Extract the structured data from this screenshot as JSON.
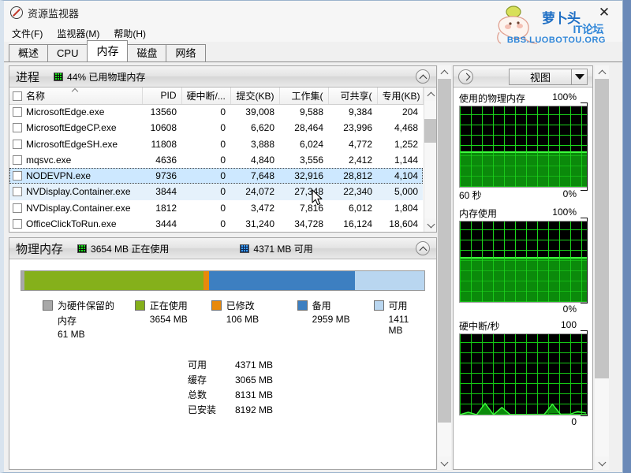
{
  "window": {
    "title": "资源监视器",
    "app_icon": "prohibited-circle-icon",
    "close_label": "✕"
  },
  "watermark": {
    "line1": "萝卜头",
    "line2": "IT论坛",
    "line3": "BBS.LUOBOTOU.ORG"
  },
  "menu": {
    "items": [
      {
        "label": "文件(F)"
      },
      {
        "label": "监视器(M)"
      },
      {
        "label": "帮助(H)"
      }
    ]
  },
  "tabs": {
    "active": "内存",
    "items": [
      {
        "label": "概述"
      },
      {
        "label": "CPU"
      },
      {
        "label": "内存"
      },
      {
        "label": "磁盘"
      },
      {
        "label": "网络"
      }
    ]
  },
  "processes_panel": {
    "title": "进程",
    "status": "44% 已用物理内存",
    "status_swatch": "green-graph-swatch",
    "collapse_icon": "chevron-up-icon",
    "columns": [
      {
        "label": "名称",
        "align": "left"
      },
      {
        "label": "PID",
        "align": "right"
      },
      {
        "label": "硬中断/...",
        "align": "right"
      },
      {
        "label": "提交(KB)",
        "align": "right"
      },
      {
        "label": "工作集(",
        "align": "right"
      },
      {
        "label": "可共享(",
        "align": "right"
      },
      {
        "label": "专用(KB)",
        "align": "right"
      }
    ],
    "rows": [
      {
        "name": "MicrosoftEdge.exe",
        "pid": "13560",
        "hard_faults": "0",
        "commit": "39,008",
        "working_set": "9,588",
        "shareable": "9,384",
        "private": "204",
        "state": "normal"
      },
      {
        "name": "MicrosoftEdgeCP.exe",
        "pid": "10608",
        "hard_faults": "0",
        "commit": "6,620",
        "working_set": "28,464",
        "shareable": "23,996",
        "private": "4,468",
        "state": "normal"
      },
      {
        "name": "MicrosoftEdgeSH.exe",
        "pid": "11808",
        "hard_faults": "0",
        "commit": "3,888",
        "working_set": "6,024",
        "shareable": "4,772",
        "private": "1,252",
        "state": "normal"
      },
      {
        "name": "mqsvc.exe",
        "pid": "4636",
        "hard_faults": "0",
        "commit": "4,840",
        "working_set": "3,556",
        "shareable": "2,412",
        "private": "1,144",
        "state": "normal"
      },
      {
        "name": "NODEVPN.exe",
        "pid": "9736",
        "hard_faults": "0",
        "commit": "7,648",
        "working_set": "32,916",
        "shareable": "28,812",
        "private": "4,104",
        "state": "selected"
      },
      {
        "name": "NVDisplay.Container.exe",
        "pid": "3844",
        "hard_faults": "0",
        "commit": "24,072",
        "working_set": "27,348",
        "shareable": "22,340",
        "private": "5,000",
        "state": "hover"
      },
      {
        "name": "NVDisplay.Container.exe",
        "pid": "1812",
        "hard_faults": "0",
        "commit": "3,472",
        "working_set": "7,816",
        "shareable": "6,012",
        "private": "1,804",
        "state": "normal"
      },
      {
        "name": "OfficeClickToRun.exe",
        "pid": "3444",
        "hard_faults": "0",
        "commit": "31,240",
        "working_set": "34,728",
        "shareable": "16,124",
        "private": "18,604",
        "state": "normal"
      }
    ]
  },
  "memory_panel": {
    "title": "物理内存",
    "stat_in_use": "3654 MB 正在使用",
    "stat_available": "4371 MB 可用",
    "collapse_icon": "chevron-up-icon",
    "bar_segments": [
      {
        "key": "hardware_reserved",
        "label": "为硬件保留的",
        "label2": "内存",
        "value": "61 MB",
        "color": "#a8a8a8",
        "pct": 0.75
      },
      {
        "key": "in_use",
        "label": "正在使用",
        "label2": "",
        "value": "3654 MB",
        "color": "#85b01b",
        "pct": 44.5
      },
      {
        "key": "modified",
        "label": "已修改",
        "label2": "",
        "value": "106 MB",
        "color": "#e8890c",
        "pct": 1.3
      },
      {
        "key": "standby",
        "label": "备用",
        "label2": "",
        "value": "2959 MB",
        "color": "#3d7fc1",
        "pct": 36.2
      },
      {
        "key": "free",
        "label": "可用",
        "label2": "",
        "value": "1411 MB",
        "color": "#b9d6f0",
        "pct": 17.25
      }
    ],
    "stats": [
      {
        "key": "可用",
        "value": "4371 MB"
      },
      {
        "key": "缓存",
        "value": "3065 MB"
      },
      {
        "key": "总数",
        "value": "8131 MB"
      },
      {
        "key": "已安装",
        "value": "8192 MB"
      }
    ]
  },
  "graph_panel": {
    "expand_icon": "chevron-right-icon",
    "view_label": "视图",
    "view_arrow_icon": "chevron-down-icon",
    "graphs": [
      {
        "title": "使用的物理内存",
        "max": "100%",
        "min": "0%",
        "footer_left": "60 秒",
        "fill_pct": 44,
        "kind": "area"
      },
      {
        "title": "内存使用",
        "max": "100%",
        "min": "0%",
        "footer_left": "",
        "fill_pct": 56,
        "kind": "area"
      },
      {
        "title": "硬中断/秒",
        "max": "100",
        "min": "0",
        "footer_left": "",
        "fill_pct": 0,
        "kind": "spikes"
      }
    ]
  },
  "chart_data": [
    {
      "type": "area",
      "title": "使用的物理内存",
      "ylabel": "",
      "xlabel": "60 秒",
      "ylim": [
        0,
        100
      ],
      "yticks": [
        "0%",
        "100%"
      ],
      "x": [
        0,
        10,
        20,
        30,
        40,
        50,
        60
      ],
      "values": [
        44,
        44,
        44,
        44,
        44,
        44,
        44
      ],
      "grid": true,
      "legend": "none"
    },
    {
      "type": "area",
      "title": "内存使用",
      "ylabel": "",
      "xlabel": "",
      "ylim": [
        0,
        100
      ],
      "yticks": [
        "0%",
        "100%"
      ],
      "x": [
        0,
        10,
        20,
        30,
        40,
        50,
        60
      ],
      "values": [
        56,
        56,
        56,
        56,
        56,
        56,
        56
      ],
      "grid": true,
      "legend": "none"
    },
    {
      "type": "line",
      "title": "硬中断/秒",
      "ylabel": "",
      "xlabel": "",
      "ylim": [
        0,
        100
      ],
      "yticks": [
        "0",
        "100"
      ],
      "x": [
        0,
        4,
        8,
        12,
        16,
        20,
        24,
        28,
        32,
        36,
        40,
        44,
        48,
        52,
        56,
        60
      ],
      "values": [
        0,
        3,
        0,
        14,
        0,
        9,
        0,
        0,
        0,
        0,
        0,
        13,
        0,
        0,
        4,
        2
      ],
      "grid": true,
      "legend": "none"
    }
  ]
}
